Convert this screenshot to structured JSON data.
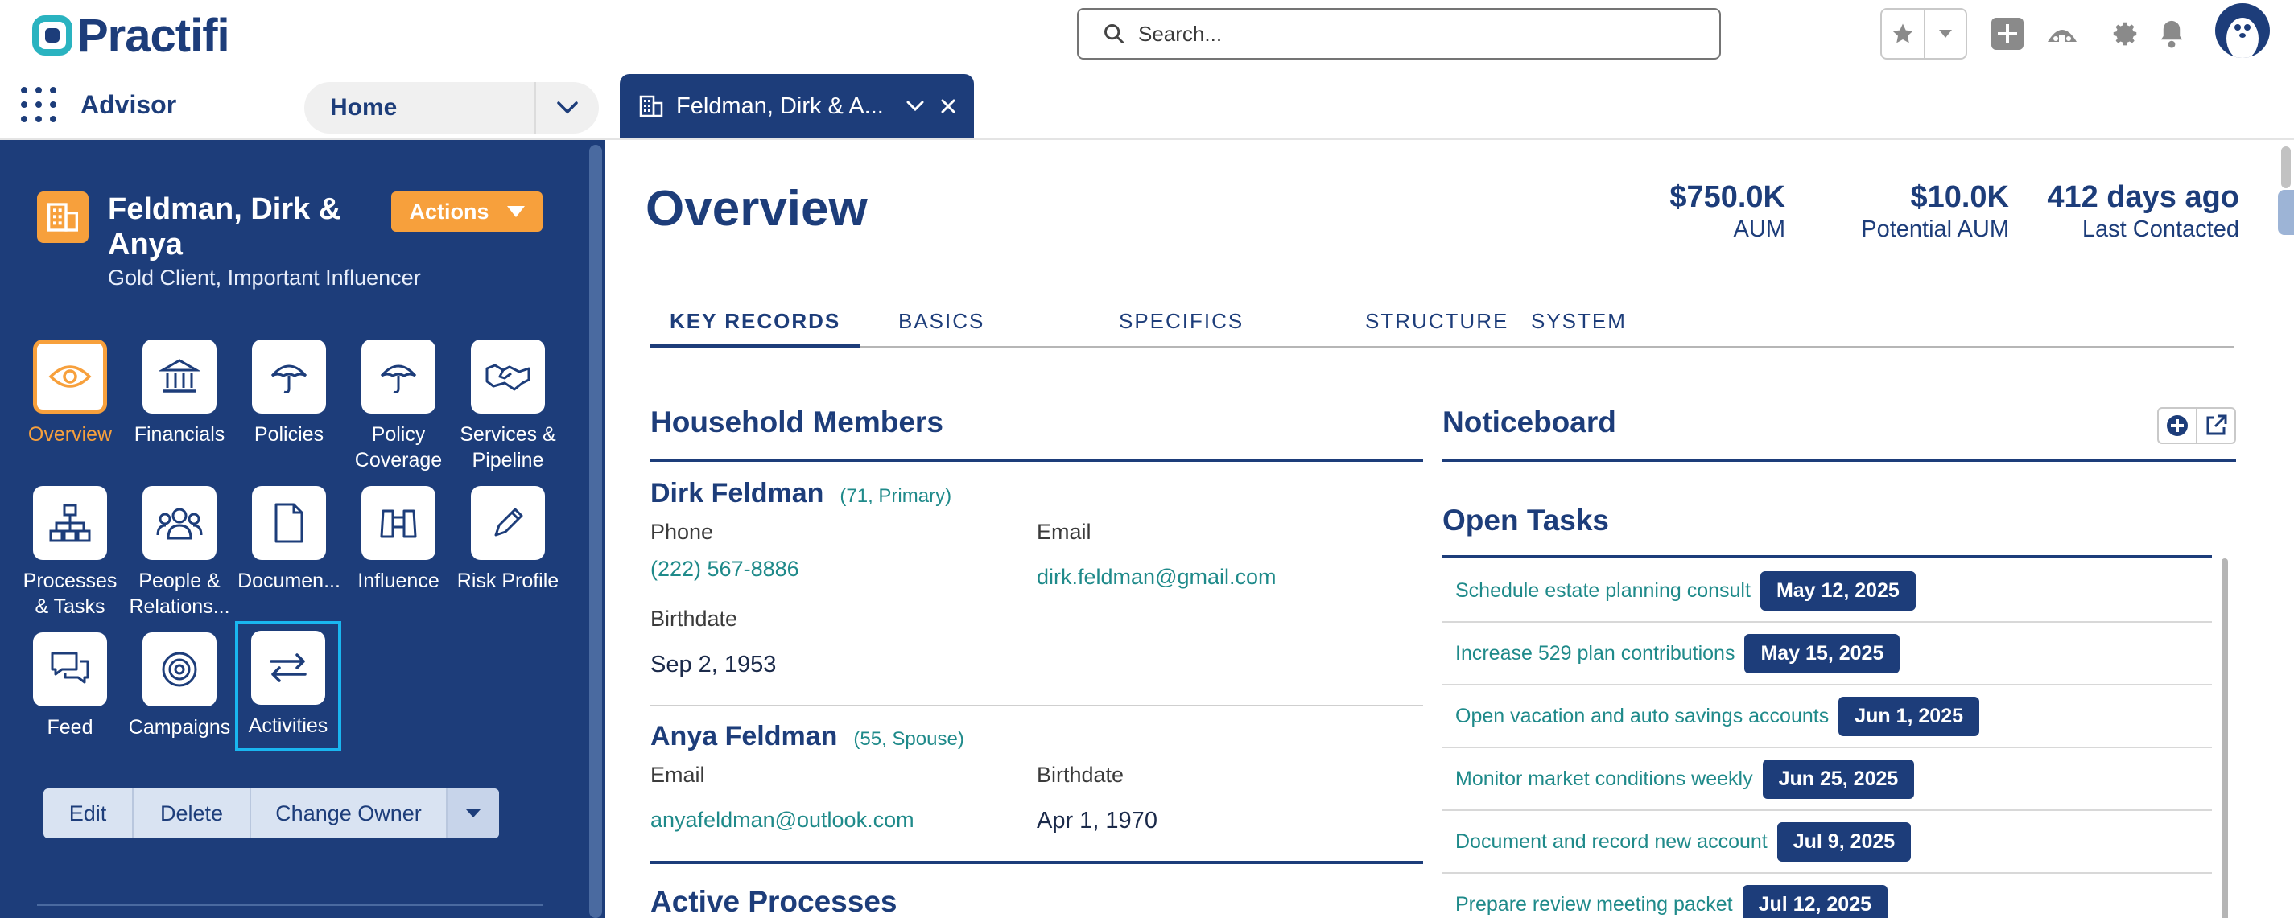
{
  "brand": {
    "name": "Practifi",
    "primary": "#1d3d7a",
    "accent": "#f7a03c",
    "link": "#1f8a8a"
  },
  "search": {
    "placeholder": "Search..."
  },
  "navbar": {
    "app_name": "Advisor",
    "home_label": "Home",
    "record_tab_label": "Feldman, Dirk & A..."
  },
  "record": {
    "name": "Feldman, Dirk & Anya",
    "subtitle": "Gold Client, Important Influencer",
    "actions_label": "Actions"
  },
  "tiles": [
    {
      "label": "Overview",
      "icon": "eye-icon"
    },
    {
      "label": "Financials",
      "icon": "bank-icon"
    },
    {
      "label": "Policies",
      "icon": "umbrella-icon"
    },
    {
      "label": "Policy Coverage",
      "icon": "umbrella-icon"
    },
    {
      "label": "Services & Pipeline",
      "icon": "handshake-icon"
    },
    {
      "label": "Processes & Tasks",
      "icon": "org-chart-icon"
    },
    {
      "label": "People & Relations...",
      "icon": "people-icon"
    },
    {
      "label": "Documen...",
      "icon": "document-icon"
    },
    {
      "label": "Influence",
      "icon": "binoculars-icon"
    },
    {
      "label": "Risk Profile",
      "icon": "pencil-icon"
    },
    {
      "label": "Feed",
      "icon": "chat-icon"
    },
    {
      "label": "Campaigns",
      "icon": "target-icon"
    },
    {
      "label": "Activities",
      "icon": "swap-icon"
    }
  ],
  "record_buttons": {
    "edit": "Edit",
    "delete": "Delete",
    "change_owner": "Change Owner"
  },
  "overview": {
    "title": "Overview",
    "stats": [
      {
        "value": "$750.0K",
        "label": "AUM"
      },
      {
        "value": "$10.0K",
        "label": "Potential AUM"
      },
      {
        "value": "412 days ago",
        "label": "Last Contacted"
      }
    ],
    "tabs": [
      "KEY RECORDS",
      "BASICS",
      "SPECIFICS",
      "STRUCTURE",
      "SYSTEM"
    ]
  },
  "household": {
    "heading": "Household Members",
    "members": [
      {
        "name": "Dirk Feldman",
        "meta": "(71, Primary)",
        "phone_label": "Phone",
        "phone": "(222) 567-8886",
        "email_label": "Email",
        "email": "dirk.feldman@gmail.com",
        "birth_label": "Birthdate",
        "birthdate": "Sep 2, 1953"
      },
      {
        "name": "Anya Feldman",
        "meta": "(55, Spouse)",
        "email_label": "Email",
        "email": "anyafeldman@outlook.com",
        "birth_label": "Birthdate",
        "birthdate": "Apr 1, 1970"
      }
    ]
  },
  "active_processes": {
    "heading": "Active Processes"
  },
  "noticeboard": {
    "heading": "Noticeboard"
  },
  "open_tasks": {
    "heading": "Open Tasks",
    "items": [
      {
        "label": "Schedule estate planning consult",
        "date": "May 12, 2025"
      },
      {
        "label": "Increase 529 plan contributions",
        "date": "May 15, 2025"
      },
      {
        "label": "Open vacation and auto savings accounts",
        "date": "Jun 1, 2025"
      },
      {
        "label": "Monitor market conditions weekly",
        "date": "Jun 25, 2025"
      },
      {
        "label": "Document and record new account",
        "date": "Jul 9, 2025"
      },
      {
        "label": "Prepare review meeting packet",
        "date": "Jul 12, 2025"
      }
    ]
  }
}
